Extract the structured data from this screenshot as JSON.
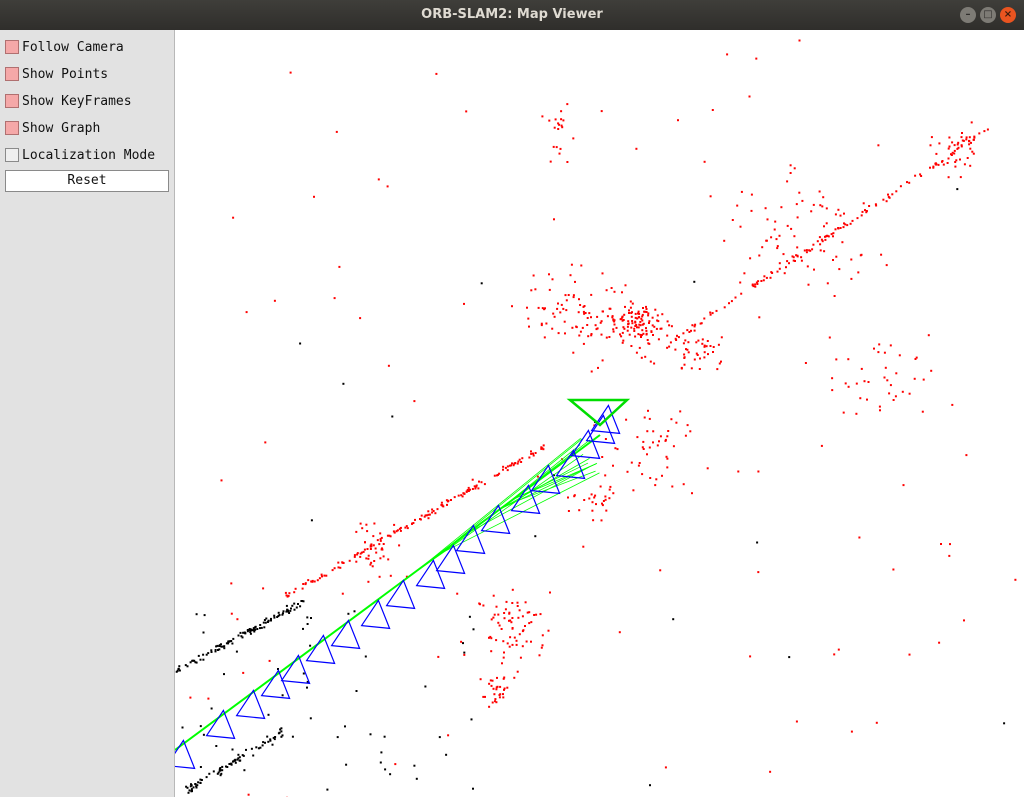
{
  "window": {
    "title": "ORB-SLAM2: Map Viewer"
  },
  "panel": {
    "checkboxes": [
      {
        "label": "Follow Camera",
        "checked": true
      },
      {
        "label": "Show Points",
        "checked": true
      },
      {
        "label": "Show KeyFrames",
        "checked": true
      },
      {
        "label": "Show Graph",
        "checked": true
      },
      {
        "label": "Localization Mode",
        "checked": false
      }
    ],
    "reset_label": "Reset"
  },
  "colors": {
    "active_map_points": "#ff0000",
    "reference_map_points": "#000000",
    "keyframes": "#0000ff",
    "current_camera": "#00dd00",
    "covisibility_graph": "#00ff00",
    "checkbox_on": "#f5a8a8"
  }
}
